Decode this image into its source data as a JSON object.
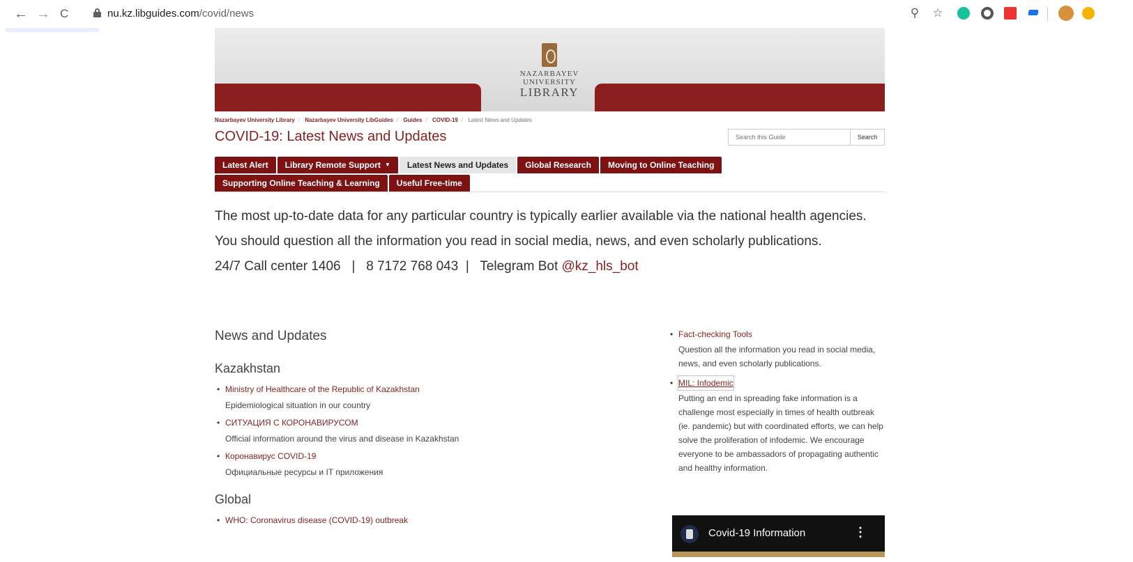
{
  "browser": {
    "url_host": "nu.kz.libguides.com",
    "url_path": "/covid/news",
    "back_icon": "←",
    "forward_icon": "→",
    "reload_icon": "C"
  },
  "logo": {
    "line1": "NAZARBAYEV",
    "line2": "UNIVERSITY",
    "line3": "LIBRARY"
  },
  "breadcrumb": {
    "items": [
      "Nazarbayev University Library",
      "Nazarbayev University LibGuides",
      "Guides",
      "COVID-19"
    ],
    "current": "Latest News and Updates",
    "sep": "/"
  },
  "page_title": "COVID-19: Latest News and Updates",
  "search": {
    "placeholder": "Search this Guide",
    "button": "Search"
  },
  "tabs": {
    "row1": [
      "Latest Alert",
      "Library Remote Support",
      "Latest News and Updates",
      "Global Research",
      "Moving to Online Teaching"
    ],
    "row2": [
      "Supporting Online Teaching & Learning",
      "Useful Free-time"
    ],
    "active": "Latest News and Updates"
  },
  "intro": {
    "p1": "The most up-to-date data for any particular country is typically earlier available via the national health agencies.",
    "p2": "You should question all the information you read in social media, news, and even scholarly publications.",
    "p3_prefix": "24/7 Call center 1406   |   8 7172 768 043  |   Telegram Bot ",
    "p3_link": "@kz_hls_bot"
  },
  "news": {
    "heading": "News and Updates",
    "kazakhstan_heading": "Kazakhstan",
    "kazakhstan_items": [
      {
        "link": "Ministry of Healthcare of the Republic of Kazakhstan",
        "desc": "Epidemiological situation in our country"
      },
      {
        "link": "СИТУАЦИЯ С КОРОНАВИРУСОМ",
        "desc": "Official information around the virus and disease in Kazakhstan"
      },
      {
        "link": "Коронавирус COVID-19",
        "desc": "Официальные ресурсы и IT приложения"
      }
    ],
    "global_heading": "Global",
    "global_items": [
      {
        "link": "WHO: Coronavirus disease (COVID-19) outbreak"
      }
    ]
  },
  "right": {
    "items": [
      {
        "link": "Fact-checking Tools",
        "desc": "Question all the information you read in social media, news, and even scholarly publications."
      },
      {
        "link": "MIL: Infodemic",
        "desc": "Putting an end in spreading fake information is a challenge most especially in times of health outbreak (ie. pandemic) but with coordinated efforts, we can help solve the proliferation of infodemic. We encourage everyone to be ambassadors of propagating authentic and healthy information."
      }
    ],
    "video_title": "Covid-19 Information",
    "video_menu": "⋮"
  },
  "colors": {
    "brand_red": "#7e1212",
    "link_red": "#8b1f1f"
  }
}
